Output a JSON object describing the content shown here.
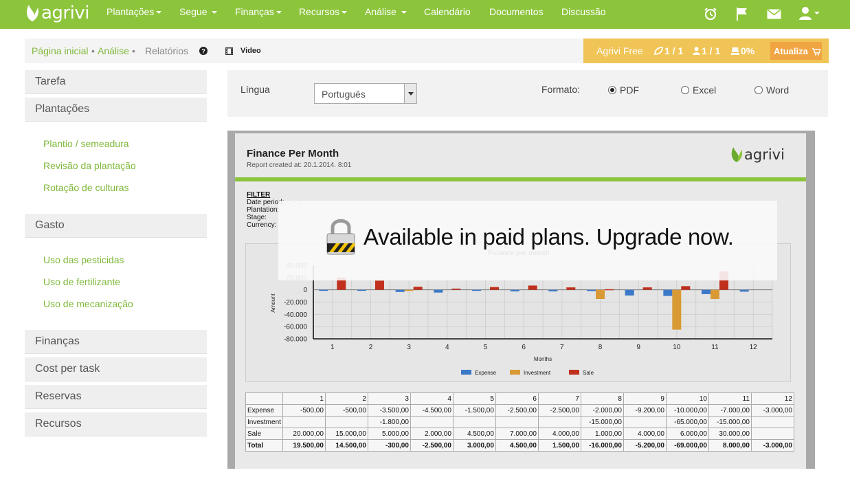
{
  "brand": {
    "name": "agrivi"
  },
  "nav": {
    "items": [
      {
        "label": "Plantações",
        "dropdown": true
      },
      {
        "label": "Segue",
        "dropdown": true
      },
      {
        "label": "Finanças",
        "dropdown": true
      },
      {
        "label": "Recursos",
        "dropdown": true
      },
      {
        "label": "Análise",
        "dropdown": true
      },
      {
        "label": "Calendário",
        "dropdown": false
      },
      {
        "label": "Documentos",
        "dropdown": false
      },
      {
        "label": "Discussão",
        "dropdown": false
      }
    ],
    "icons": [
      "alarm-clock-icon",
      "flag-icon",
      "mail-icon",
      "user-icon"
    ]
  },
  "breadcrumb": {
    "home": "Página inicial",
    "analysis": "Análise",
    "current": "Relatórios",
    "help_icon": "help-icon",
    "video_label": "Video"
  },
  "plan": {
    "name": "Agrivi Free",
    "fields": "1 / 1",
    "users": "1 / 1",
    "storage": "0%",
    "upgrade": "Atualiza"
  },
  "sidebar": {
    "tarefa": "Tarefa",
    "plantacoes": "Plantações",
    "plantacoes_items": [
      "Plantio / semeadura",
      "Revisão da plantação",
      "Rotação de culturas"
    ],
    "gasto": "Gasto",
    "gasto_items": [
      "Uso das pesticidas",
      "Uso de fertilizante",
      "Uso de mecanização"
    ],
    "financas": "Finanças",
    "cost_per_task": "Cost per task",
    "reservas": "Reservas",
    "recursos": "Recursos"
  },
  "options": {
    "language_label": "Língua",
    "language_value": "Português",
    "format_label": "Formato:",
    "formats": [
      {
        "label": "PDF",
        "selected": true
      },
      {
        "label": "Excel",
        "selected": false
      },
      {
        "label": "Word",
        "selected": false
      }
    ]
  },
  "report": {
    "title": "Finance Per Month",
    "created": "Report created at: 20.1.2014. 8:01",
    "logo": "agrivi",
    "filter_title": "FILTER",
    "filter_lines": [
      "Date period: ... - ...",
      "Plantation:",
      "Stage:",
      "Currency:"
    ],
    "upgrade_message": "Available in paid plans. Upgrade now.",
    "table": {
      "header": [
        "",
        "1",
        "2",
        "3",
        "4",
        "5",
        "6",
        "7",
        "8",
        "9",
        "10",
        "11",
        "12"
      ],
      "rows": [
        [
          "Expense",
          "-500,00",
          "-500,00",
          "-3.500,00",
          "-4.500,00",
          "-1.500,00",
          "-2.500,00",
          "-2.500,00",
          "-2.000,00",
          "-9.200,00",
          "-10.000,00",
          "-7.000,00",
          "-3.000,00"
        ],
        [
          "Investment",
          "",
          "",
          "-1.800,00",
          "",
          "",
          "",
          "",
          "-15.000,00",
          "",
          "-65.000,00",
          "-15.000,00",
          ""
        ],
        [
          "Sale",
          "20.000,00",
          "15.000,00",
          "5.000,00",
          "2.000,00",
          "4.500,00",
          "7.000,00",
          "4.000,00",
          "1.000,00",
          "4.000,00",
          "6.000,00",
          "30.000,00",
          ""
        ],
        [
          "Total",
          "19.500,00",
          "14.500,00",
          "-300,00",
          "-2.500,00",
          "3.000,00",
          "4.500,00",
          "1.500,00",
          "-16.000,00",
          "-5.200,00",
          "-69.000,00",
          "8.000,00",
          "-3.000,00"
        ]
      ]
    }
  },
  "chart_data": {
    "type": "bar",
    "title": "Finance per month",
    "xlabel": "Months",
    "ylabel": "Amount",
    "categories": [
      "1",
      "2",
      "3",
      "4",
      "5",
      "6",
      "7",
      "8",
      "9",
      "10",
      "11",
      "12"
    ],
    "ylim": [
      -80000,
      40000
    ],
    "yticks": [
      "40.000",
      "20.000",
      "0",
      "-20.000",
      "-40.000",
      "-60.000",
      "-80.000"
    ],
    "legend_position": "bottom",
    "series": [
      {
        "name": "Expense",
        "color": "#3a78c8",
        "values": [
          -500,
          -500,
          -3500,
          -4500,
          -1500,
          -2500,
          -2500,
          -2000,
          -9200,
          -10000,
          -7000,
          -3000
        ]
      },
      {
        "name": "Investment",
        "color": "#d99a35",
        "values": [
          0,
          0,
          -1800,
          0,
          0,
          0,
          0,
          -15000,
          0,
          -65000,
          -15000,
          0
        ]
      },
      {
        "name": "Sale",
        "color": "#c0301c",
        "values": [
          20000,
          15000,
          5000,
          2000,
          4500,
          7000,
          4000,
          1000,
          4000,
          6000,
          30000,
          0
        ]
      }
    ]
  }
}
